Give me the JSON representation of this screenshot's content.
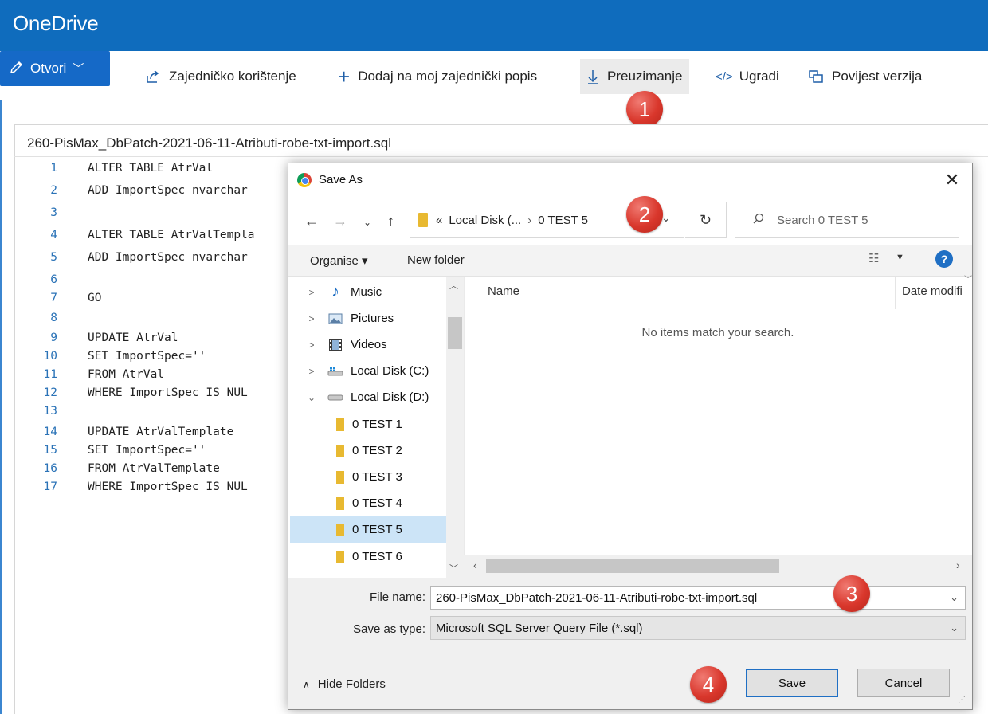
{
  "app": {
    "title": "OneDrive",
    "header_color": "#0f6cbd"
  },
  "toolbar": {
    "open_label": "Otvori",
    "share_label": "Zajedničko korištenje",
    "add_label": "Dodaj na moj zajednički popis",
    "download_label": "Preuzimanje",
    "embed_label": "Ugradi",
    "version_label": "Povijest verzija"
  },
  "document": {
    "filename": "260-PisMax_DbPatch-2021-06-11-Atributi-robe-txt-import.sql",
    "lines": [
      {
        "n": "1",
        "text": "ALTER TABLE AtrVal"
      },
      {
        "n": "2",
        "text": "ADD ImportSpec nvarchar"
      },
      {
        "n": "3",
        "text": ""
      },
      {
        "n": "4",
        "text": "ALTER TABLE AtrValTempla"
      },
      {
        "n": "5",
        "text": "ADD ImportSpec nvarchar"
      },
      {
        "n": "6",
        "text": ""
      },
      {
        "n": "7",
        "text": "GO"
      },
      {
        "n": "8",
        "text": ""
      },
      {
        "n": "9",
        "text": "UPDATE AtrVal"
      },
      {
        "n": "10",
        "text": "SET ImportSpec=''"
      },
      {
        "n": "11",
        "text": "FROM AtrVal"
      },
      {
        "n": "12",
        "text": "WHERE ImportSpec IS NUL"
      },
      {
        "n": "13",
        "text": ""
      },
      {
        "n": "14",
        "text": "UPDATE AtrValTemplate"
      },
      {
        "n": "15",
        "text": "SET ImportSpec=''"
      },
      {
        "n": "16",
        "text": "FROM AtrValTemplate"
      },
      {
        "n": "17",
        "text": "WHERE ImportSpec IS NUL"
      }
    ]
  },
  "badges": [
    "1",
    "2",
    "3",
    "4"
  ],
  "dialog": {
    "title": "Save As",
    "address": {
      "prefix": "«",
      "part1": "Local Disk (...",
      "part2": "0 TEST 5"
    },
    "search_placeholder": "Search 0 TEST 5",
    "organise_label": "Organise ▾",
    "new_folder_label": "New folder",
    "help_label": "?",
    "nav_items": [
      {
        "label": "Music",
        "icon": "music-icon",
        "twisty": ">"
      },
      {
        "label": "Pictures",
        "icon": "pictures-icon",
        "twisty": ">"
      },
      {
        "label": "Videos",
        "icon": "videos-icon",
        "twisty": ">"
      },
      {
        "label": "Local Disk (C:)",
        "icon": "drive-icon",
        "twisty": ">"
      },
      {
        "label": "Local Disk (D:)",
        "icon": "drive-icon",
        "twisty": "⌄"
      }
    ],
    "folders": [
      "0 TEST 1",
      "0 TEST 2",
      "0 TEST 3",
      "0 TEST 4",
      "0 TEST 5",
      "0 TEST 6"
    ],
    "selected_folder": "0 TEST 5",
    "columns": {
      "name": "Name",
      "date": "Date modifi"
    },
    "empty_message": "No items match your search.",
    "file_name_label": "File name:",
    "file_name_value": "260-PisMax_DbPatch-2021-06-11-Atributi-robe-txt-import.sql",
    "save_type_label": "Save as type:",
    "save_type_value": "Microsoft SQL Server Query File (*.sql)",
    "hide_folders_label": "Hide Folders",
    "save_label": "Save",
    "cancel_label": "Cancel"
  }
}
